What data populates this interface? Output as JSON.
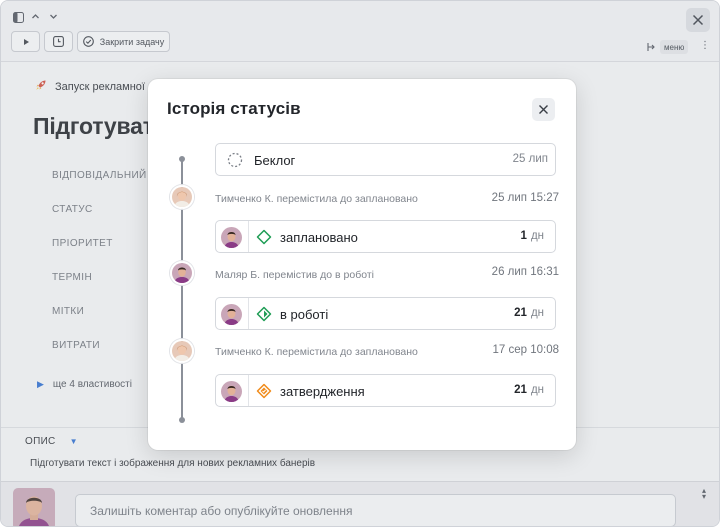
{
  "toolbar": {
    "close_task_label": "Закрити задачу",
    "menu_label": "меню"
  },
  "page": {
    "breadcrumb": "Запуск рекламної",
    "title": "Підготувати",
    "properties": [
      "ВІДПОВІДАЛЬНИЙ",
      "СТАТУС",
      "ПРІОРИТЕТ",
      "ТЕРМІН",
      "МІТКИ",
      "ВИТРАТИ"
    ],
    "more_properties": "ще 4 властивості",
    "description_label": "ОПИС",
    "description_text": "Підготувати текст і зображення для нових рекламних банерів",
    "comment_placeholder": "Залишіть коментар або опублікуйте оновлення"
  },
  "modal": {
    "title": "Історія статусів",
    "initial": {
      "status": "Беклог",
      "date": "25 лип",
      "icon": "dashed-circle-icon"
    },
    "events": [
      {
        "text": "Тимченко К. перемістила до заплановано",
        "time": "25 лип 15:27",
        "status": "заплановано",
        "icon": "diamond-icon",
        "color": "#1f9d55",
        "duration_value": "1",
        "duration_unit": "дн"
      },
      {
        "text": "Маляр Б. перемістив до в роботі",
        "time": "26 лип 16:31",
        "status": "в роботі",
        "icon": "progress-circle-icon",
        "color": "#1f9d55",
        "duration_value": "21",
        "duration_unit": "дн"
      },
      {
        "text": "Тимченко К. перемістила до заплановано",
        "time": "17 сер 10:08",
        "status": "затвердження",
        "icon": "review-icon",
        "color": "#f08c1c",
        "duration_value": "21",
        "duration_unit": "дн"
      }
    ]
  }
}
